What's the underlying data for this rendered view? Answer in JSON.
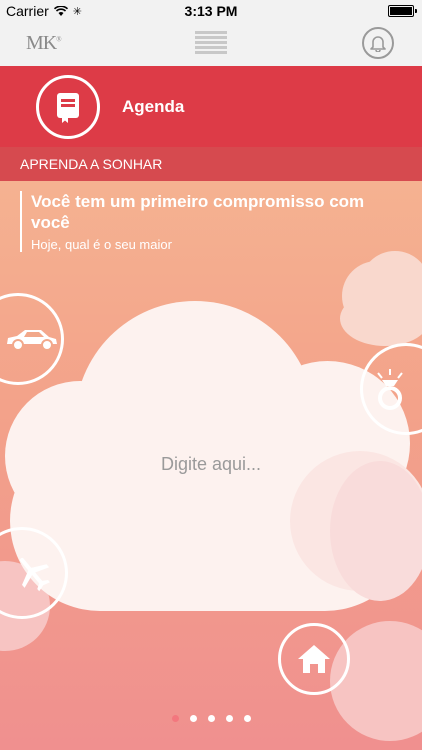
{
  "statusbar": {
    "carrier": "Carrier",
    "time": "3:13 PM"
  },
  "navbar": {
    "logo": "MK",
    "logo_mark": "®"
  },
  "header": {
    "title": "Agenda"
  },
  "section": {
    "title": "APRENDA A SONHAR"
  },
  "intro": {
    "heading": "Você tem um primeiro compromisso com você",
    "subtext": "Hoje, qual é o seu maior"
  },
  "input": {
    "placeholder": "Digite aqui..."
  },
  "icons": [
    "car-icon",
    "ring-icon",
    "airplane-icon",
    "home-icon",
    "book-icon",
    "bell-icon",
    "menu-icon"
  ],
  "pager": {
    "pages": 5,
    "active": 1
  },
  "colors": {
    "header_red": "#dd3b47",
    "section_red": "#d64a4f",
    "gradient_top": "#f5b291",
    "gradient_bottom": "#f0908f"
  }
}
